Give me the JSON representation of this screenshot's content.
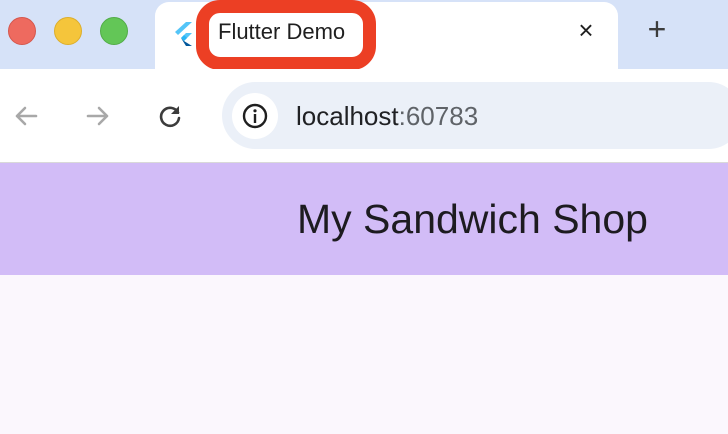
{
  "browser": {
    "tab": {
      "title": "Flutter Demo",
      "favicon": "flutter-logo-icon",
      "close_icon": "×"
    },
    "new_tab_icon": "+",
    "toolbar": {
      "back_icon": "arrow-left-icon",
      "forward_icon": "arrow-right-icon",
      "reload_icon": "reload-icon",
      "site_info_icon": "info-icon"
    },
    "address_bar": {
      "host": "localhost",
      "port": ":60783"
    }
  },
  "app": {
    "title": "My Sandwich Shop",
    "appbar_color": "#d2bcf7",
    "background_color": "#fbf7fd"
  },
  "annotation": {
    "highlight_color": "#ec3f24"
  }
}
